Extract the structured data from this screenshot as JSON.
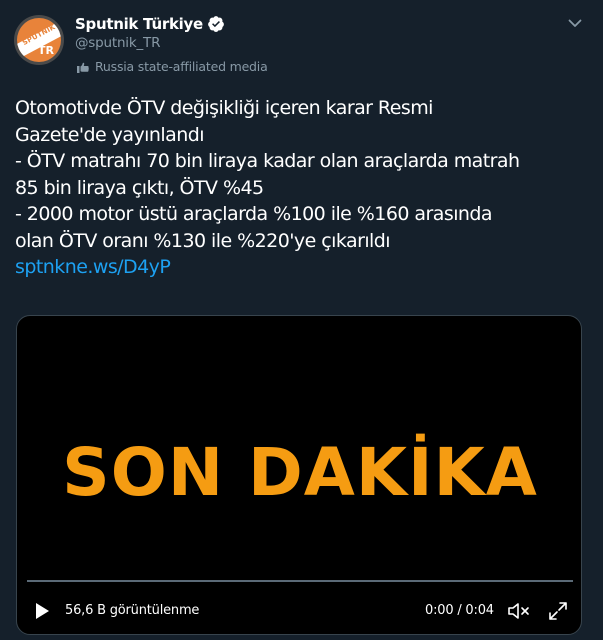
{
  "author": {
    "display_name": "Sputnik Türkiye",
    "handle": "@sputnik_TR",
    "verified": true,
    "affiliation_label": "Russia state-affiliated media",
    "avatar_text": "SPUTNIK",
    "avatar_badge": "TR"
  },
  "tweet": {
    "lines": [
      "Otomotivde ÖTV değişikliği içeren karar Resmi",
      "Gazete'de yayınlandı",
      "- ÖTV matrahı 70 bin liraya kadar olan araçlarda matrah",
      "85 bin liraya çıktı, ÖTV %45",
      "- 2000 motor üstü araçlarda %100 ile %160 arasında",
      "olan ÖTV oranı  %130 ile %220'ye çıkarıldı"
    ],
    "link": "sptnkne.ws/D4yP"
  },
  "media": {
    "headline": "SON DAKİKA",
    "views": "56,6 B görüntülenme",
    "time": "0:00 / 0:04",
    "progress": 0
  },
  "icons": {
    "menu": "chevron-down-icon",
    "verified": "verified-badge-icon",
    "affiliation": "hand-flag-icon",
    "play": "play-icon",
    "mute": "speaker-muted-icon",
    "fullscreen": "fullscreen-icon"
  },
  "colors": {
    "background": "#15202b",
    "accent": "#1da1f2",
    "secondary_text": "#8899a6",
    "headline": "#f59c12"
  }
}
